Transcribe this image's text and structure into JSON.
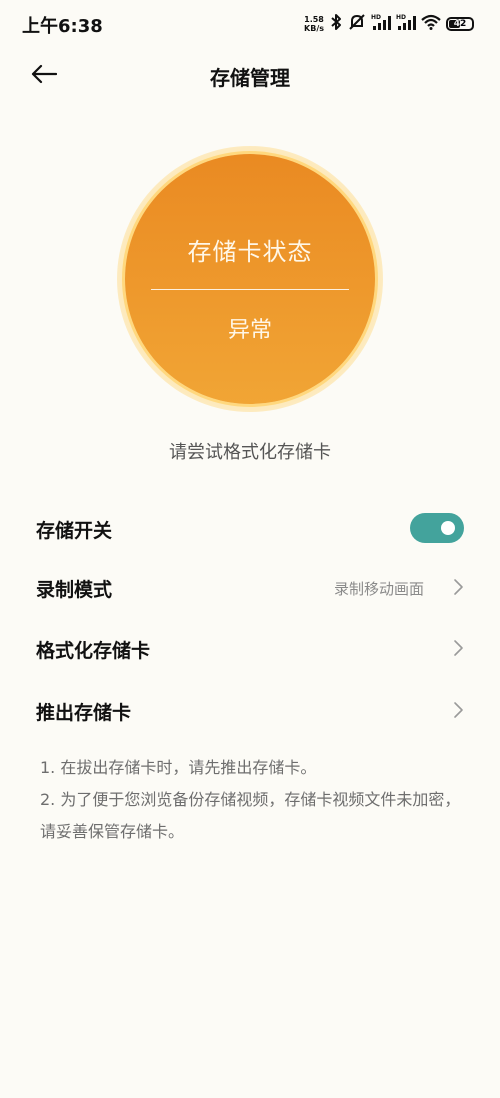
{
  "status_bar": {
    "time": "上午6:38",
    "net_speed_value": "1.58",
    "net_speed_unit": "KB/s",
    "battery": "42"
  },
  "header": {
    "title": "存储管理"
  },
  "status_circle": {
    "title": "存储卡状态",
    "status": "异常"
  },
  "hint": "请尝试格式化存储卡",
  "settings": {
    "storage_switch": {
      "label": "存储开关",
      "enabled": true
    },
    "record_mode": {
      "label": "录制模式",
      "value": "录制移动画面"
    },
    "format_card": {
      "label": "格式化存储卡"
    },
    "eject_card": {
      "label": "推出存储卡"
    }
  },
  "notes": {
    "line1": "1. 在拔出存储卡时，请先推出存储卡。",
    "line2": "2. 为了便于您浏览备份存储视频，存储卡视频文件未加密，请妥善保管存储卡。"
  },
  "colors": {
    "background": "#fcfbf6",
    "circle_top": "#ea8a22",
    "circle_bottom": "#f1a535",
    "toggle_on": "#43a39c"
  },
  "icons": [
    "back-arrow-icon",
    "bluetooth-icon",
    "mute-icon",
    "signal-icon",
    "wifi-icon",
    "battery-icon",
    "chevron-right-icon"
  ]
}
